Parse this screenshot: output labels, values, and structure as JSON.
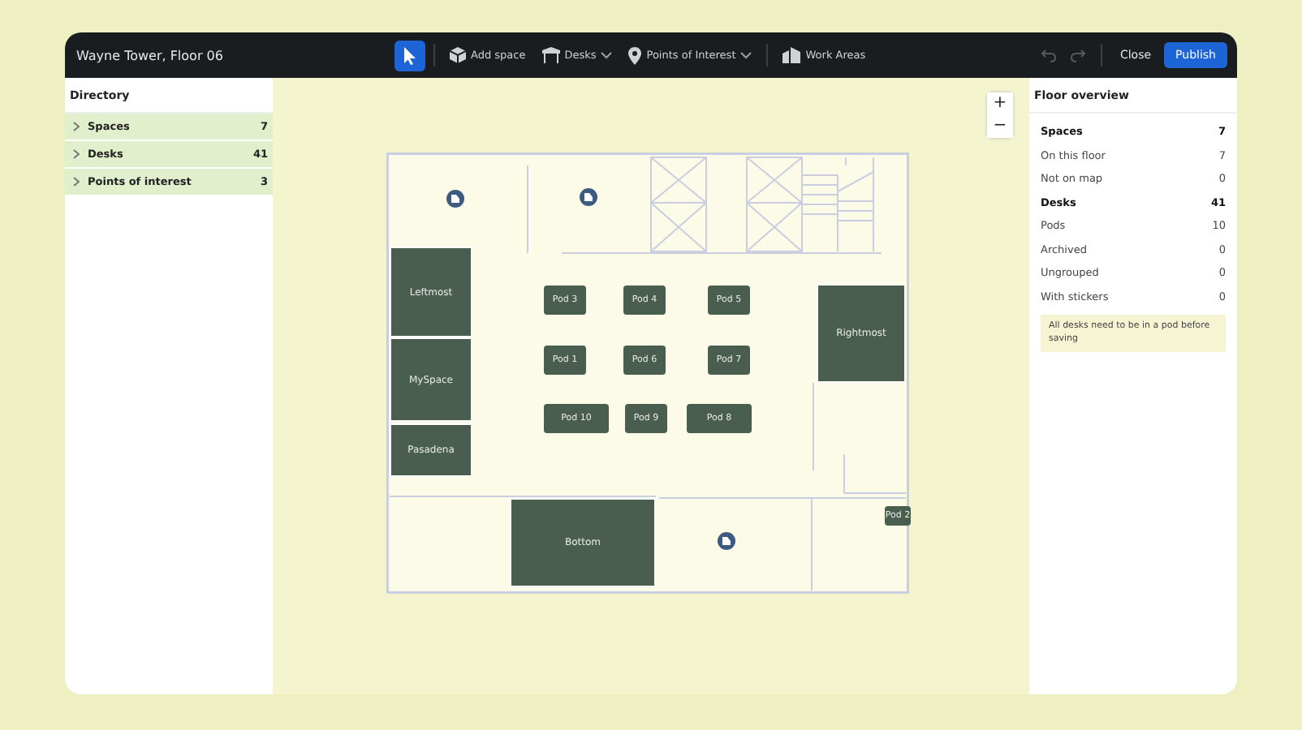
{
  "window": {
    "title": "Wayne Tower, Floor 06"
  },
  "toolbar": {
    "tools": [
      {
        "kind": "select",
        "selected": true
      },
      {
        "kind": "space",
        "label": "Add space",
        "selected": false
      },
      {
        "kind": "desks",
        "label": "Desks",
        "selected": false,
        "dropdown": true
      },
      {
        "kind": "poi",
        "label": "Points of Interest",
        "selected": false,
        "dropdown": true
      },
      {
        "kind": "areas",
        "label": "Work Areas",
        "selected": false
      }
    ],
    "undo_disabled": true,
    "redo_disabled": true,
    "close": "Close",
    "publish": "Publish"
  },
  "directory": {
    "title": "Directory",
    "items": [
      {
        "label": "Spaces",
        "count": "7",
        "expanded": false
      },
      {
        "label": "Desks",
        "count": "41",
        "expanded": false
      },
      {
        "label": "Points of interest",
        "count": "3",
        "expanded": false
      }
    ]
  },
  "zoom": {
    "in": "+",
    "out": "−"
  },
  "floor_plan": {
    "rooms": [
      "Leftmost",
      "MySpace",
      "Pasadena",
      "Rightmost",
      "Bottom"
    ],
    "pods": [
      "Pod 3",
      "Pod 4",
      "Pod 5",
      "Pod 1",
      "Pod 6",
      "Pod 7",
      "Pod 10",
      "Pod 9",
      "Pod 8",
      "Pod 2"
    ]
  },
  "overview": {
    "title": "Floor overview",
    "rows": [
      {
        "kind": "header",
        "label": "Spaces",
        "value": "7"
      },
      {
        "kind": "sub",
        "label": "On this floor",
        "value": "7"
      },
      {
        "kind": "sub",
        "label": "Not on map",
        "value": "0"
      },
      {
        "kind": "header",
        "label": "Desks",
        "value": "41"
      },
      {
        "kind": "sub",
        "label": "Pods",
        "value": "10"
      },
      {
        "kind": "sub",
        "label": "Archived",
        "value": "0"
      },
      {
        "kind": "sub",
        "label": "Ungrouped",
        "value": "0"
      },
      {
        "kind": "sub",
        "label": "With stickers",
        "value": "0"
      }
    ],
    "warning": "All desks need to be in a pod before saving"
  }
}
